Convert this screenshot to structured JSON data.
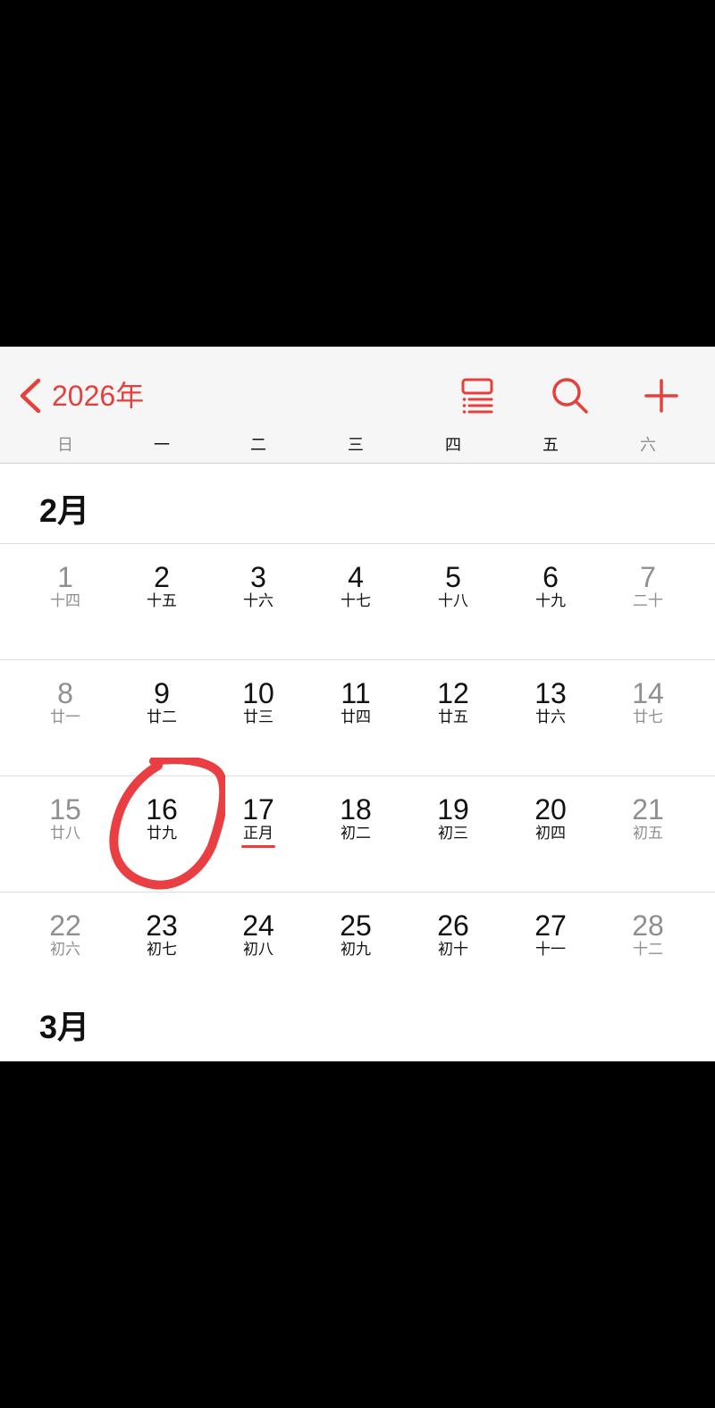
{
  "header": {
    "year_label": "2026年",
    "accent_color": "#e5403c",
    "icons": {
      "back": "chevron-left-icon",
      "list_view": "list-view-icon",
      "search": "search-icon",
      "add": "plus-icon"
    }
  },
  "weekdays": [
    "日",
    "一",
    "二",
    "三",
    "四",
    "五",
    "六"
  ],
  "months": [
    {
      "title": "2月",
      "weeks": [
        [
          {
            "day": "1",
            "lunar": "十四"
          },
          {
            "day": "2",
            "lunar": "十五"
          },
          {
            "day": "3",
            "lunar": "十六"
          },
          {
            "day": "4",
            "lunar": "十七"
          },
          {
            "day": "5",
            "lunar": "十八"
          },
          {
            "day": "6",
            "lunar": "十九"
          },
          {
            "day": "7",
            "lunar": "二十"
          }
        ],
        [
          {
            "day": "8",
            "lunar": "廿一"
          },
          {
            "day": "9",
            "lunar": "廿二"
          },
          {
            "day": "10",
            "lunar": "廿三"
          },
          {
            "day": "11",
            "lunar": "廿四"
          },
          {
            "day": "12",
            "lunar": "廿五"
          },
          {
            "day": "13",
            "lunar": "廿六"
          },
          {
            "day": "14",
            "lunar": "廿七"
          }
        ],
        [
          {
            "day": "15",
            "lunar": "廿八"
          },
          {
            "day": "16",
            "lunar": "廿九"
          },
          {
            "day": "17",
            "lunar": "正月"
          },
          {
            "day": "18",
            "lunar": "初二"
          },
          {
            "day": "19",
            "lunar": "初三"
          },
          {
            "day": "20",
            "lunar": "初四"
          },
          {
            "day": "21",
            "lunar": "初五"
          }
        ],
        [
          {
            "day": "22",
            "lunar": "初六"
          },
          {
            "day": "23",
            "lunar": "初七"
          },
          {
            "day": "24",
            "lunar": "初八"
          },
          {
            "day": "25",
            "lunar": "初九"
          },
          {
            "day": "26",
            "lunar": "初十"
          },
          {
            "day": "27",
            "lunar": "十一"
          },
          {
            "day": "28",
            "lunar": "十二"
          }
        ]
      ]
    },
    {
      "title": "3月"
    }
  ]
}
